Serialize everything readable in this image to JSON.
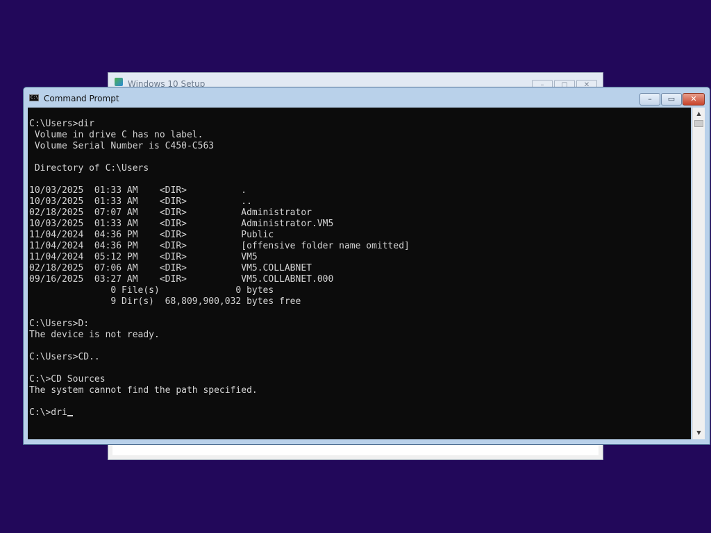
{
  "desktop": {
    "background_color": "#22085a"
  },
  "setup_window": {
    "title": "Windows 10 Setup",
    "controls": [
      "–",
      "▢",
      "✕"
    ]
  },
  "cmd_window": {
    "title": "Command Prompt",
    "icon": "cmd-icon",
    "controls": {
      "minimize": "–",
      "maximize": "▭",
      "close": "✕"
    },
    "lines": [
      "",
      "C:\\Users>dir",
      " Volume in drive C has no label.",
      " Volume Serial Number is C450-C563",
      "",
      " Directory of C:\\Users",
      "",
      "10/03/2025  01:33 AM    <DIR>          .",
      "10/03/2025  01:33 AM    <DIR>          ..",
      "02/18/2025  07:07 AM    <DIR>          Administrator",
      "10/03/2025  01:33 AM    <DIR>          Administrator.VM5",
      "11/04/2024  04:36 PM    <DIR>          Public",
      "11/04/2024  04:36 PM    <DIR>          [offensive folder name omitted]",
      "11/04/2024  05:12 PM    <DIR>          VM5",
      "02/18/2025  07:06 AM    <DIR>          VM5.COLLABNET",
      "09/16/2025  03:27 AM    <DIR>          VM5.COLLABNET.000",
      "               0 File(s)              0 bytes",
      "               9 Dir(s)  68,809,900,032 bytes free",
      "",
      "C:\\Users>D:",
      "The device is not ready.",
      "",
      "C:\\Users>CD..",
      "",
      "C:\\>CD Sources",
      "The system cannot find the path specified.",
      "",
      "C:\\>dri"
    ]
  }
}
